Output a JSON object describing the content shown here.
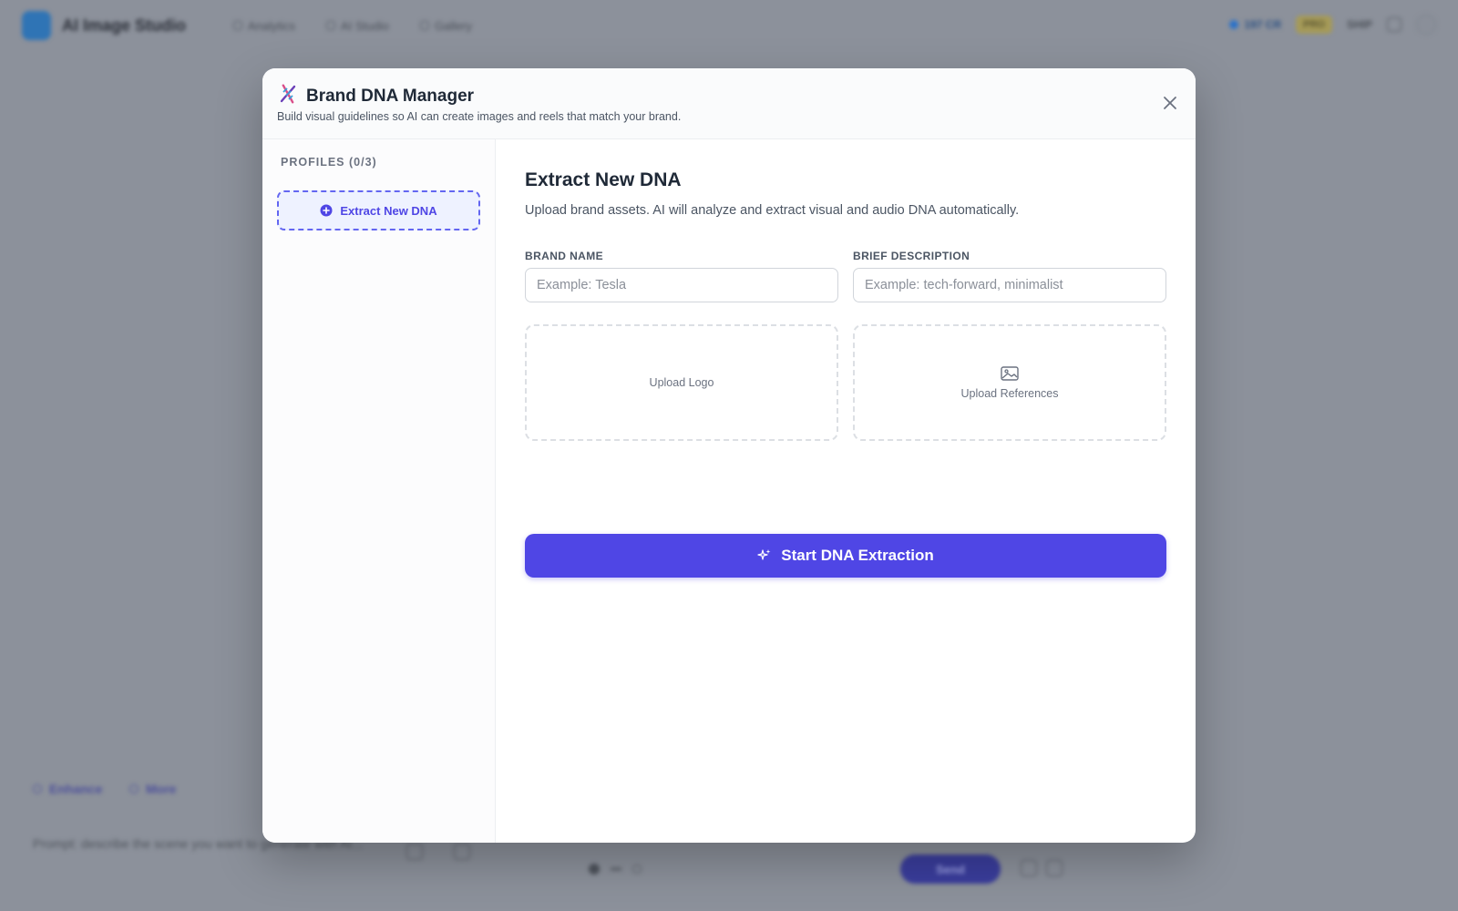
{
  "background_app": {
    "app_title": "AI Image Studio",
    "nav": [
      "Analytics",
      "AI Studio",
      "Gallery"
    ],
    "credits": "197 CR",
    "plan_badge": "PRO",
    "user": "SHIP",
    "actions": [
      "Enhance",
      "More"
    ],
    "prompt_placeholder": "Prompt: describe the scene you want to generate with AI...",
    "send_label": "Send"
  },
  "modal": {
    "icon": "dna-icon",
    "title": "Brand DNA Manager",
    "subtitle": "Build visual guidelines so AI can create images and reels that match your brand.",
    "close_icon": "close-icon"
  },
  "sidebar": {
    "heading": "PROFILES (0/3)",
    "extract_button": "Extract New DNA"
  },
  "main": {
    "title": "Extract New DNA",
    "description": "Upload brand assets. AI will analyze and extract visual and audio DNA automatically.",
    "brand_name": {
      "label": "BRAND NAME",
      "placeholder": "Example: Tesla",
      "value": ""
    },
    "brief_description": {
      "label": "BRIEF DESCRIPTION",
      "placeholder": "Example: tech-forward, minimalist",
      "value": ""
    },
    "upload_logo": "Upload Logo",
    "upload_references": "Upload References",
    "start_button": "Start DNA Extraction"
  },
  "colors": {
    "accent": "#4f46e5",
    "accent_light": "#eef2ff",
    "overlay": "#8c919b"
  }
}
